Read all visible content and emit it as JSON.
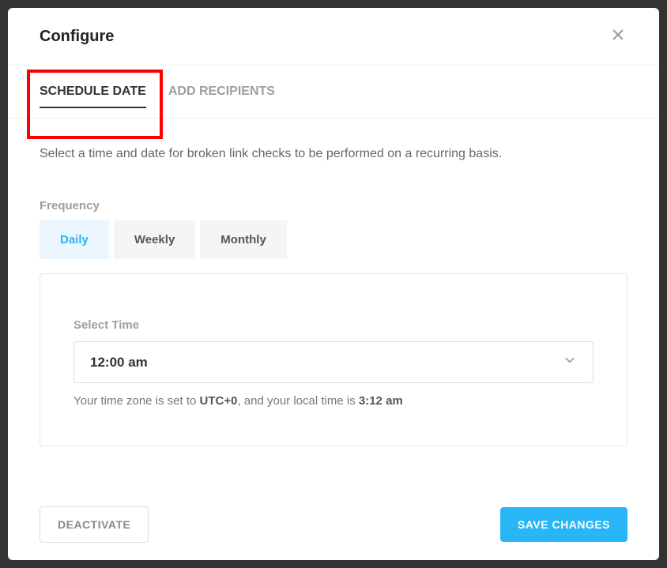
{
  "header": {
    "title": "Configure"
  },
  "tabs": {
    "schedule_date": "SCHEDULE DATE",
    "add_recipients": "ADD RECIPIENTS"
  },
  "description": "Select a time and date for broken link checks to be performed on a recurring basis.",
  "frequency": {
    "label": "Frequency",
    "daily": "Daily",
    "weekly": "Weekly",
    "monthly": "Monthly"
  },
  "time_panel": {
    "label": "Select Time",
    "value": "12:00 am",
    "tz_prefix": "Your time zone is set to ",
    "tz_value": "UTC+0",
    "tz_mid": ", and your local time is ",
    "tz_local": "3:12 am"
  },
  "footer": {
    "deactivate": "DEACTIVATE",
    "save": "SAVE CHANGES"
  }
}
